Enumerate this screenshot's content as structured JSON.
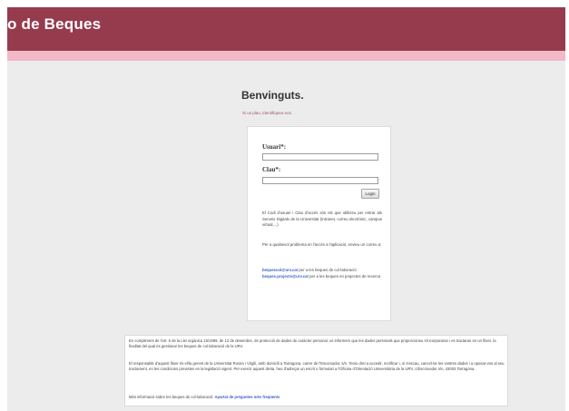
{
  "header": {
    "title": "o de Beques"
  },
  "main": {
    "welcome": "Benvinguts.",
    "identify_prompt": "Si us plau, identifiqueu-vos."
  },
  "login": {
    "user_label": "Usuari*:",
    "password_label": "Clau*:",
    "login_button": "Login"
  },
  "info": {
    "text1": "El Codi d'usuari i Clau d'accés són els que utilitzeu per entrar als Serveis Digitals de la Universitat (Intranet, correu electrònic, campus virtual,...)",
    "text2": "Per a qualsevol problema en l'accés a l'aplicació, envieu un correu a:",
    "contact1_email": "bequescol@urv.cat",
    "contact1_desc": " per a les beques de col·laboració",
    "contact2_email": "beques.projecte@urv.cat",
    "contact2_desc": " per a les beques en projectes de recerca"
  },
  "footer": {
    "p1": "En compliment de l'art. 5 de la Llei orgànica 15/1999, de 13 de desembre, de protecció de dades de caràcter personal, us informem que les dades personals que proporcioneu s'incorporaran i es tractaran en un fitxer, la finalitat del qual és gestionar les beques de col·laboració de la URV.",
    "p2": "El responsable d'aquest fitxer és el/la gerent de la Universitat Rovira i Virgili, amb domicili a Tarragona, carrer de l'Escorxador, s/n. Teniu dret a accedir, rectificar i, si s'escau, cancel·lar les vostres dades i a oposar-vos al seu tractament, en les condicions previstes en la legislació vigent. Per exercir aquest dreta, heu d'adreçar un escrit o formulari a l'Oficina d'Orientació Universitària de la URV, c/Escorxador s/n, 43003 Tarragona.",
    "p3_text": "Més informació sobre les beques de col·laboració: ",
    "p3_link": "Apartat de preguntes més freqüents"
  },
  "colors": {
    "header_bg": "#963b4e",
    "accent_bar": "#f2b9c6",
    "page_bg": "#ececec",
    "link": "#3e63c7"
  }
}
